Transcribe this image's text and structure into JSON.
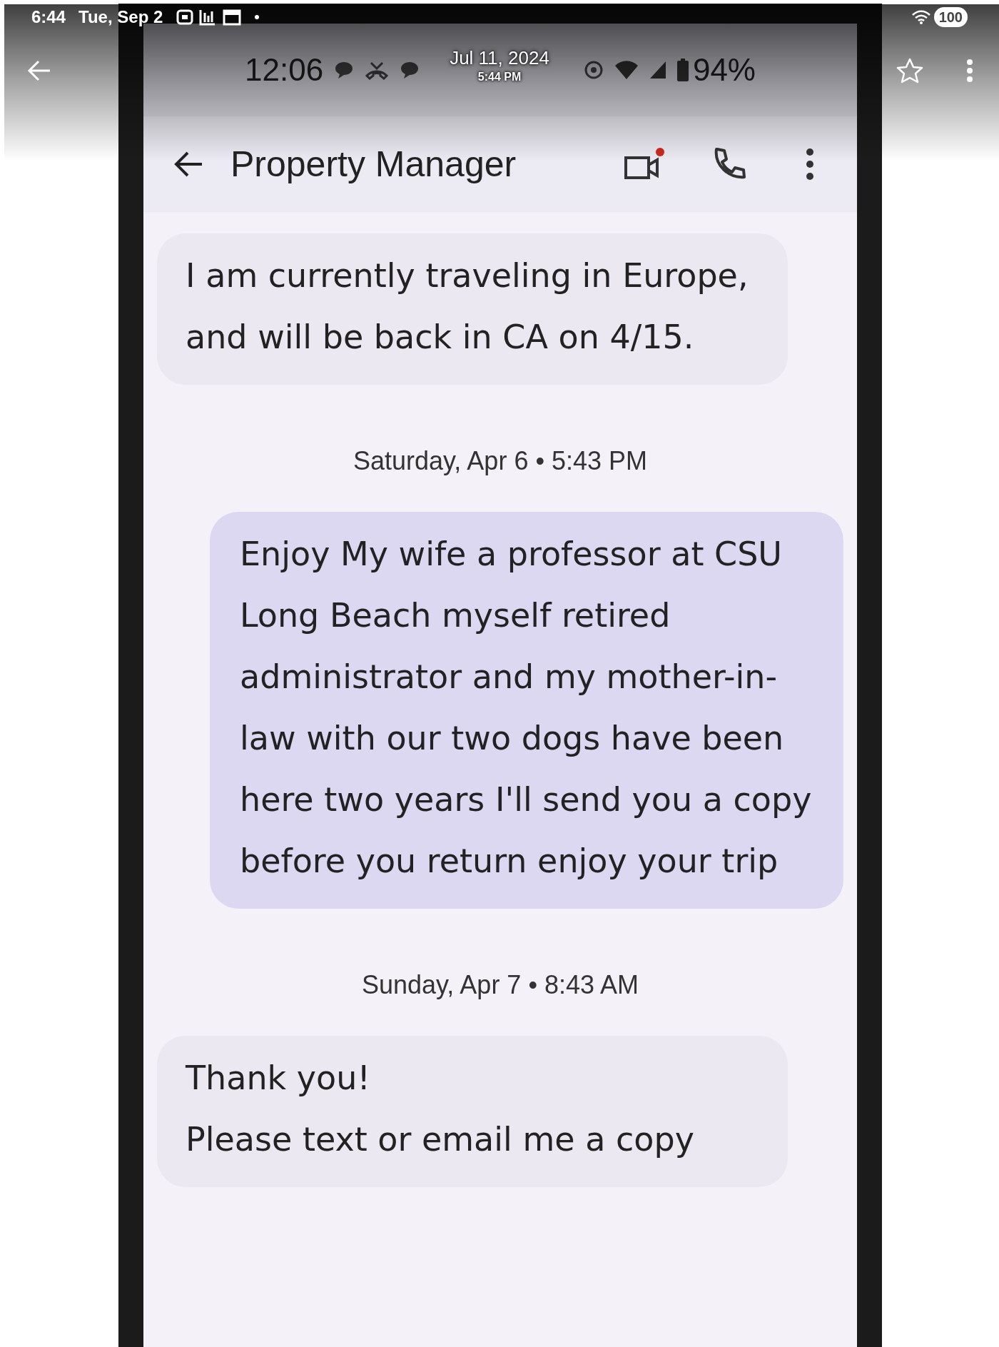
{
  "device_status_bar": {
    "time": "6:44",
    "date": "Tue, Sep 2",
    "battery": "100"
  },
  "screenshot": {
    "timestamp_overlay": {
      "date": "Jul 11, 2024",
      "time": "5:44 PM"
    },
    "status_bar": {
      "time": "12:06",
      "battery": "94%"
    },
    "conversation_header": {
      "title": "Property Manager"
    },
    "messages": [
      {
        "kind": "incoming",
        "text": "I am currently traveling in Europe, and will be back in CA on 4/15."
      },
      {
        "kind": "date",
        "text": "Saturday, Apr 6 • 5:43 PM"
      },
      {
        "kind": "outgoing",
        "text": "Enjoy My wife a professor at CSU Long Beach myself retired administrator and my mother-in-law with our two dogs have been here two years I'll send you a copy before you return enjoy your trip"
      },
      {
        "kind": "date",
        "text": "Sunday, Apr 7 • 8:43 AM"
      },
      {
        "kind": "incoming",
        "text": "Thank you!\nPlease text or email me a copy"
      }
    ]
  }
}
